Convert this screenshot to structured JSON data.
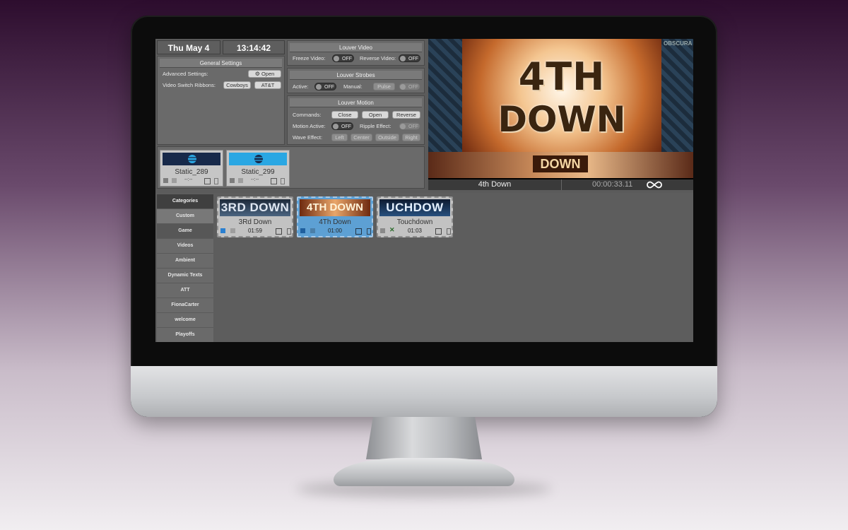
{
  "header": {
    "date": "Thu May 4",
    "time": "13:14:42"
  },
  "general_settings": {
    "title": "General Settings",
    "advanced_label": "Advanced Settings:",
    "open_label": "Open",
    "ribbons_label": "Video Switch Ribbons:",
    "cowboys_label": "Cowboys",
    "att_label": "AT&T"
  },
  "louver_video": {
    "title": "Louver Video",
    "freeze_label": "Freeze Video:",
    "freeze_state": "OFF",
    "reverse_label": "Reverse Video:",
    "reverse_state": "OFF"
  },
  "louver_strobes": {
    "title": "Louver Strobes",
    "active_label": "Active:",
    "active_state": "OFF",
    "manual_label": "Manual:",
    "pulse_label": "Pulse",
    "manual_state": "OFF"
  },
  "louver_motion": {
    "title": "Louver Motion",
    "commands_label": "Commands:",
    "close_label": "Close",
    "open_label": "Open",
    "reverse_label": "Reverse",
    "motion_active_label": "Motion Active:",
    "motion_active_state": "OFF",
    "ripple_label": "Ripple Effect:",
    "ripple_state": "OFF",
    "wave_label": "Wave Effect:",
    "wave_left": "Left",
    "wave_center": "Center",
    "wave_outside": "Outside",
    "wave_right": "Right"
  },
  "statics": [
    {
      "name": "Static_289",
      "time": "--:--",
      "color": "#17294a"
    },
    {
      "name": "Static_299",
      "time": "--:--",
      "color": "#2aa7e3"
    }
  ],
  "preview": {
    "brand": "OBSCURA",
    "big_line1": "4TH",
    "big_line2": "DOWN",
    "small_text": "DOWN",
    "now_playing": "4th Down",
    "timecode": "00:00:33.11"
  },
  "categories": {
    "header": "Categories",
    "items": [
      "Custom",
      "Game",
      "Videos",
      "Ambient",
      "Dynamic Texts",
      "ATT",
      "FionaCarter",
      "welcome",
      "Playoffs"
    ]
  },
  "clips": [
    {
      "art_text": "3RD DOWN",
      "title": "3Rd Down",
      "duration": "01:59"
    },
    {
      "art_text": "4TH DOWN",
      "title": "4Th Down",
      "duration": "01:00"
    },
    {
      "art_text": "UCHDOW",
      "title": "Touchdown",
      "duration": "01:03"
    }
  ],
  "colors": {
    "accent_blue": "#5da0d4",
    "att_dark": "#17294a",
    "att_light": "#2aa7e3"
  }
}
